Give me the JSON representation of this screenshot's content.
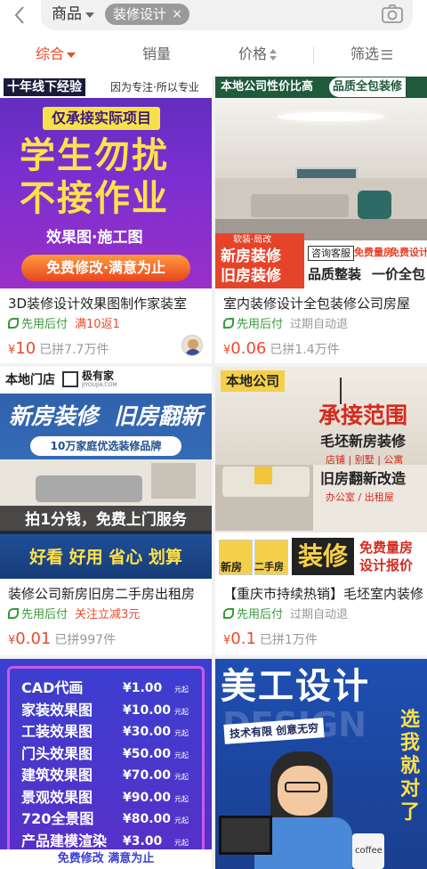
{
  "search": {
    "scope": "商品",
    "chip": "装修设计",
    "chip_close": "×"
  },
  "sort": {
    "comprehensive": "综合",
    "sales": "销量",
    "price": "价格",
    "filter": "筛选"
  },
  "colors": {
    "accent": "#e94b2c",
    "green": "#3a9a3c",
    "muted": "#999999"
  },
  "icons": [
    "back-icon",
    "camera-icon",
    "caret-down-icon",
    "sort-arrows-icon",
    "filter-icon",
    "leaf-icon",
    "close-icon"
  ],
  "products": [
    {
      "title": "3D装修设计效果图制作家装室",
      "tag1": "先用后付",
      "tag2": "满10返1",
      "yen": "¥",
      "price": "10",
      "sold": "已拼7.7万件",
      "banner": {
        "left": "十年线下经验",
        "right": "因为专注·所以专业",
        "top": "仅承接实际项目",
        "l1": "学生勿扰",
        "l2": "不接作业",
        "l3": "效果图·施工图",
        "btn": "免费修改·满意为止"
      }
    },
    {
      "title": "室内装修设计全包装修公司房屋",
      "tag1": "先用后付",
      "tag2": "过期自动退",
      "yen": "¥",
      "price": "0.06",
      "sold": "已拼1.4万件",
      "banner": {
        "left": "本地公司性价比高",
        "right": "品质全包装修",
        "small": "软装·局改",
        "l1": "新房装修",
        "l2": "旧房装修",
        "b1": "咨询客服",
        "b2": "免费量房",
        "b3": "免费设计",
        "b4": "品质整装",
        "b5": "一价全包"
      }
    },
    {
      "title": "装修公司新房旧房二手房出租房",
      "tag1": "先用后付",
      "tag2": "关注立减3元",
      "yen": "¥",
      "price": "0.01",
      "sold": "已拼997件",
      "banner": {
        "top": "本地门店",
        "brand": "极有家",
        "brand_sub": "JIYOUJIA.COM",
        "l1": "新房装修",
        "l2": "旧房翻新",
        "sub": "10万家庭优选装修品牌",
        "mid": "拍1分钱，免费上门服务",
        "bottom": "好看 好用 省心 划算"
      }
    },
    {
      "title": "【重庆市持续热销】毛坯室内装修",
      "tag1": "先用后付",
      "tag2": "过期自动退",
      "yen": "¥",
      "price": "0.1",
      "sold": "已拼1万件",
      "banner": {
        "top": "本地公司",
        "head": "承接范围",
        "r1": "毛坯新房装修",
        "r2": "店铺 | 别墅 | 公寓",
        "r3": "旧房翻新改造",
        "r4": "办公室 / 出租屋",
        "big": "装修",
        "i1": "新房",
        "i2": "二手房",
        "b1": "免费量房",
        "b2": "设计报价"
      }
    },
    {
      "banner": {
        "items": [
          {
            "name": "CAD代画",
            "price": "¥1.00",
            "unit": "元起"
          },
          {
            "name": "家装效果图",
            "price": "¥10.00",
            "unit": "元起"
          },
          {
            "name": "工装效果图",
            "price": "¥30.00",
            "unit": "元起"
          },
          {
            "name": "门头效果图",
            "price": "¥50.00",
            "unit": "元起"
          },
          {
            "name": "建筑效果图",
            "price": "¥70.00",
            "unit": "元起"
          },
          {
            "name": "景观效果图",
            "price": "¥90.00",
            "unit": "元起"
          },
          {
            "name": "720全景图",
            "price": "¥80.00",
            "unit": "元起"
          },
          {
            "name": "产品建模渲染",
            "price": "¥3.00",
            "unit": "元起"
          }
        ],
        "bottom": "免费修改 满意为止"
      }
    },
    {
      "banner": {
        "l1": "美工设计",
        "bg": "DESIGN",
        "tag": "技术有限 创意无穷",
        "side": "选我就对了",
        "cup": "coffee"
      }
    }
  ]
}
